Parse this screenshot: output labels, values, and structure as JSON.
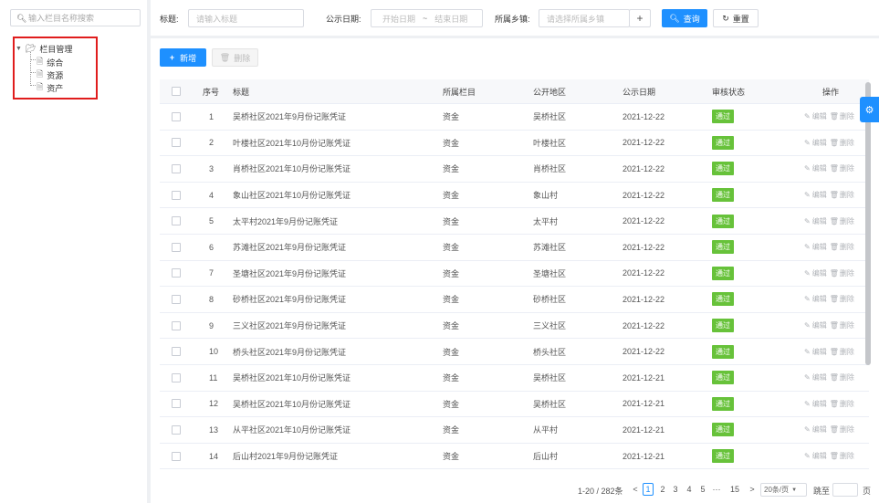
{
  "tree": {
    "search_placeholder": "输入栏目名称搜索",
    "root_label": "栏目管理",
    "children": [
      "综合",
      "资源",
      "资产"
    ]
  },
  "filters": {
    "title_label": "标题:",
    "title_placeholder": "请输入标题",
    "date_label": "公示日期:",
    "date_start_placeholder": "开始日期",
    "date_sep": "~",
    "date_end_placeholder": "结束日期",
    "area_label": "所属乡镇:",
    "area_placeholder": "请选择所属乡镇",
    "add_symbol": "+",
    "query_label": "查询",
    "reset_label": "重置"
  },
  "toolbar": {
    "new_label": "新增",
    "delete_label": "删除"
  },
  "table": {
    "columns": [
      "序号",
      "标题",
      "所属栏目",
      "公开地区",
      "公示日期",
      "审核状态",
      "操作"
    ],
    "rows": [
      {
        "no": "1",
        "title": "吴桥社区2021年9月份记账凭证",
        "column": "资金",
        "area": "吴桥社区",
        "date": "2021-12-22",
        "status": "通过"
      },
      {
        "no": "2",
        "title": "叶楼社区2021年10月份记账凭证",
        "column": "资金",
        "area": "叶楼社区",
        "date": "2021-12-22",
        "status": "通过"
      },
      {
        "no": "3",
        "title": "肖桥社区2021年10月份记账凭证",
        "column": "资金",
        "area": "肖桥社区",
        "date": "2021-12-22",
        "status": "通过"
      },
      {
        "no": "4",
        "title": "象山社区2021年10月份记账凭证",
        "column": "资金",
        "area": "象山村",
        "date": "2021-12-22",
        "status": "通过"
      },
      {
        "no": "5",
        "title": "太平村2021年9月份记账凭证",
        "column": "资金",
        "area": "太平村",
        "date": "2021-12-22",
        "status": "通过"
      },
      {
        "no": "6",
        "title": "苏滩社区2021年9月份记账凭证",
        "column": "资金",
        "area": "苏滩社区",
        "date": "2021-12-22",
        "status": "通过"
      },
      {
        "no": "7",
        "title": "圣塘社区2021年9月份记账凭证",
        "column": "资金",
        "area": "圣塘社区",
        "date": "2021-12-22",
        "status": "通过"
      },
      {
        "no": "8",
        "title": "砂桥社区2021年9月份记账凭证",
        "column": "资金",
        "area": "砂桥社区",
        "date": "2021-12-22",
        "status": "通过"
      },
      {
        "no": "9",
        "title": "三义社区2021年9月份记账凭证",
        "column": "资金",
        "area": "三义社区",
        "date": "2021-12-22",
        "status": "通过"
      },
      {
        "no": "10",
        "title": "桥头社区2021年9月份记账凭证",
        "column": "资金",
        "area": "桥头社区",
        "date": "2021-12-22",
        "status": "通过"
      },
      {
        "no": "11",
        "title": "吴桥社区2021年10月份记账凭证",
        "column": "资金",
        "area": "吴桥社区",
        "date": "2021-12-21",
        "status": "通过"
      },
      {
        "no": "12",
        "title": "吴桥社区2021年10月份记账凭证",
        "column": "资金",
        "area": "吴桥社区",
        "date": "2021-12-21",
        "status": "通过"
      },
      {
        "no": "13",
        "title": "从平社区2021年10月份记账凭证",
        "column": "资金",
        "area": "从平村",
        "date": "2021-12-21",
        "status": "通过"
      },
      {
        "no": "14",
        "title": "后山村2021年9月份记账凭证",
        "column": "资金",
        "area": "后山村",
        "date": "2021-12-21",
        "status": "通过"
      }
    ],
    "edit_label": "编辑",
    "delete_label": "删除"
  },
  "pagination": {
    "range_text": "1-20 / 282条",
    "prev": "<",
    "pages": [
      "1",
      "2",
      "3",
      "4",
      "5",
      "···",
      "15"
    ],
    "next": ">",
    "page_size": "20条/页",
    "goto_label": "跳至",
    "page_suffix": "页"
  }
}
